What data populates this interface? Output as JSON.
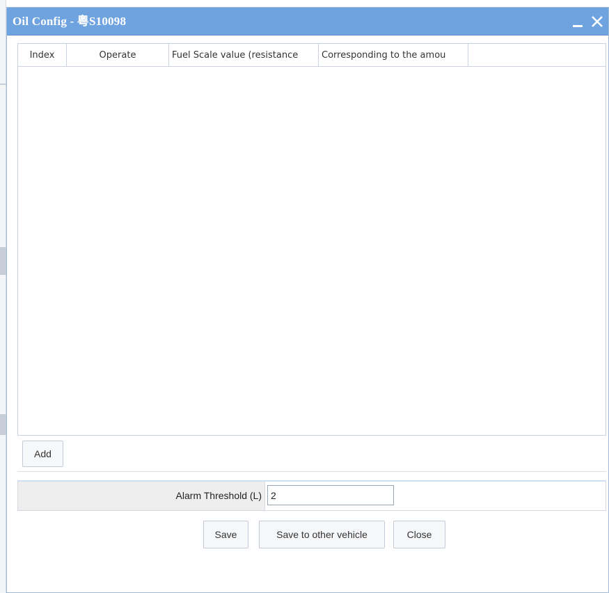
{
  "window": {
    "title": "Oil Config  -  粤S10098",
    "minimize_glyph": "_",
    "close_icon": "close-icon"
  },
  "colors": {
    "titlebar": "#6ea3e0",
    "grid_border": "#c9d3de",
    "label_cell": "#eeeeee"
  },
  "grid": {
    "columns": [
      "Index",
      "Operate",
      "Fuel Scale value (resistance",
      "Corresponding to the amou"
    ],
    "rows": []
  },
  "add_label": "Add",
  "threshold": {
    "label": "Alarm Threshold (L)",
    "value": "2"
  },
  "footer": {
    "save_label": "Save",
    "save_other_label": "Save to other vehicle",
    "close_label": "Close"
  }
}
